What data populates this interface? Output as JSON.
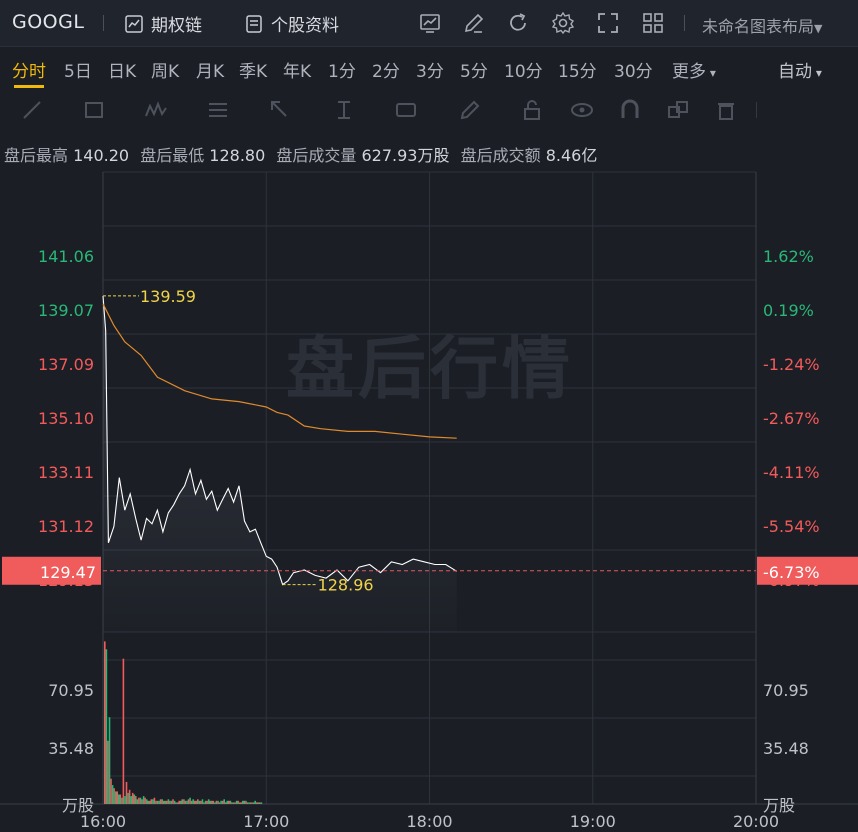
{
  "toolbar": {
    "ticker": "GOOGL",
    "options_chain": "期权链",
    "stock_profile": "个股资料",
    "layout_name": "未命名图表布局",
    "icons": [
      "chart-line-icon",
      "draw-pen-icon",
      "refresh-icon",
      "settings-gear-icon",
      "fullscreen-icon",
      "grid-layout-icon"
    ]
  },
  "periods": {
    "items": [
      "分时",
      "5日",
      "日K",
      "周K",
      "月K",
      "季K",
      "年K",
      "1分",
      "2分",
      "3分",
      "5分",
      "10分",
      "15分",
      "30分",
      "更多"
    ],
    "active": "分时",
    "right_mode": "自动"
  },
  "draw_tools": [
    "line-tool-icon",
    "rect-tool-icon",
    "pattern-tool-icon",
    "fib-tool-icon",
    "arrow-tool-icon",
    "measure-tool-icon",
    "text-tool-icon",
    "brush-tool-icon",
    "lock-icon",
    "eye-icon",
    "magnet-icon",
    "clone-icon",
    "trash-icon"
  ],
  "info": {
    "high_label": "盘后最高",
    "high": "140.20",
    "low_label": "盘后最低",
    "low": "128.80",
    "vol_label": "盘后成交量",
    "vol": "627.93万股",
    "amt_label": "盘后成交额",
    "amt": "8.46亿"
  },
  "watermark": "盘后行情",
  "colors": {
    "up": "#29b877",
    "down": "#f35a5a",
    "price_line": "#ffffff",
    "avg_line": "#e08a2c",
    "accent": "#f0b90b"
  },
  "chart_data": {
    "type": "line",
    "title": "",
    "x_ticks": [
      "16:00",
      "17:00",
      "18:00",
      "19:00",
      "20:00"
    ],
    "price_ticks_left": [
      "141.06",
      "139.07",
      "137.09",
      "135.10",
      "133.11",
      "131.12",
      "129.13"
    ],
    "pct_ticks_right": [
      "1.62%",
      "0.19%",
      "-1.24%",
      "-2.67%",
      "-4.11%",
      "-5.54%",
      "-6.97%"
    ],
    "current_price": "129.47",
    "current_pct": "-6.73%",
    "max_marker": "139.59",
    "min_marker": "128.96",
    "ylim": [
      128.5,
      141.5
    ],
    "price_series": {
      "name": "价格",
      "x": [
        "16:00",
        "16:01",
        "16:02",
        "16:04",
        "16:06",
        "16:08",
        "16:10",
        "16:12",
        "16:14",
        "16:16",
        "16:18",
        "16:20",
        "16:22",
        "16:24",
        "16:26",
        "16:28",
        "16:30",
        "16:32",
        "16:34",
        "16:36",
        "16:38",
        "16:40",
        "16:42",
        "16:44",
        "16:46",
        "16:48",
        "16:50",
        "16:52",
        "16:54",
        "16:56",
        "16:58",
        "17:00",
        "17:02",
        "17:04",
        "17:06",
        "17:08",
        "17:10",
        "17:14",
        "17:18",
        "17:22",
        "17:26",
        "17:30",
        "17:34",
        "17:38",
        "17:42",
        "17:46",
        "17:50",
        "17:54",
        "17:58",
        "18:02",
        "18:06",
        "18:10"
      ],
      "values": [
        139.59,
        138.3,
        130.5,
        131.1,
        132.9,
        131.7,
        132.3,
        131.4,
        130.6,
        131.4,
        131.2,
        131.7,
        130.9,
        131.6,
        131.9,
        132.3,
        132.6,
        133.2,
        132.3,
        132.8,
        132.1,
        132.4,
        131.7,
        132.1,
        132.5,
        132.0,
        132.6,
        131.3,
        130.9,
        131.0,
        130.5,
        130.0,
        129.9,
        129.6,
        128.96,
        129.1,
        129.4,
        129.5,
        129.3,
        129.2,
        129.5,
        129.1,
        129.6,
        129.7,
        129.4,
        129.8,
        129.7,
        129.9,
        129.8,
        129.7,
        129.7,
        129.45
      ]
    },
    "avg_series": {
      "name": "均价",
      "x": [
        "16:00",
        "16:04",
        "16:08",
        "16:14",
        "16:20",
        "16:30",
        "16:40",
        "16:50",
        "17:00",
        "17:04",
        "17:08",
        "17:14",
        "17:20",
        "17:30",
        "17:40",
        "17:50",
        "18:00",
        "18:10"
      ],
      "values": [
        139.3,
        138.5,
        137.9,
        137.4,
        136.6,
        136.1,
        135.8,
        135.7,
        135.5,
        135.3,
        135.2,
        134.8,
        134.7,
        134.6,
        134.6,
        134.5,
        134.4,
        134.35
      ]
    },
    "volume": {
      "ylabel": "万股",
      "y_ticks": [
        "70.95",
        "35.48"
      ],
      "ylim": [
        0,
        106.4
      ],
      "values_up": [
        98,
        55,
        12,
        8,
        6,
        4,
        5,
        7,
        5,
        6,
        3,
        4,
        5,
        3,
        2,
        3,
        2,
        2,
        3,
        2,
        3,
        2,
        2,
        1,
        2,
        3,
        2,
        4,
        3,
        2,
        2,
        3,
        2,
        3,
        2,
        1,
        2,
        2,
        3,
        2,
        2,
        1,
        2,
        1,
        2,
        2,
        1,
        1,
        2,
        1,
        1
      ],
      "values_down": [
        103,
        40,
        16,
        10,
        8,
        6,
        92,
        14,
        9,
        7,
        5,
        4,
        3,
        4,
        2,
        3,
        4,
        2,
        3,
        2,
        2,
        2,
        3,
        1,
        2,
        3,
        2,
        3,
        2,
        2,
        3,
        2,
        1,
        2,
        2,
        2,
        2,
        1,
        2,
        1,
        2,
        1,
        1,
        2,
        1,
        2,
        1,
        1,
        1,
        1,
        1
      ]
    }
  }
}
